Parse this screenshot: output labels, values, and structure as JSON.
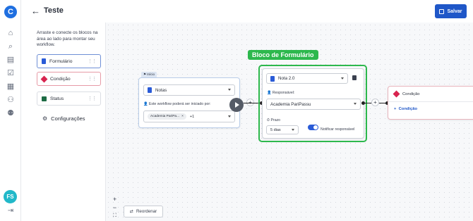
{
  "header": {
    "title": "Teste",
    "save_label": "Salvar"
  },
  "rail": {
    "avatar_initials": "FS",
    "icons": [
      "home-icon",
      "search-doc-icon",
      "document-icon",
      "checklist-icon",
      "chart-icon",
      "org-icon",
      "users-icon"
    ]
  },
  "panel": {
    "hint": "Arraste e conecte os blocos na área ao lado para montar seu workflow.",
    "blocks": [
      {
        "label": "Formulário",
        "color": "#2a5bd7"
      },
      {
        "label": "Condição",
        "color": "#d8244f"
      },
      {
        "label": "Status",
        "color": "#1d6b44"
      }
    ],
    "config_label": "Configurações"
  },
  "canvas": {
    "start_node": {
      "tag": "Início",
      "form_select": "Notas",
      "start_label": "Este workflow poderá ser iniciado por:",
      "chip": "Academia PariPa...",
      "extra": "+1"
    },
    "highlight_label": "Bloco de Formulário",
    "form_node": {
      "form_select": "Nota 2.0",
      "responsible_label": "Responsável:",
      "responsible_value": "Academia PariPassu",
      "deadline_label": "Prazo",
      "deadline_value": "5 dias",
      "notify_label": "Notificar responsável",
      "notify_on": true
    },
    "condition_node": {
      "title": "Condição",
      "add_label": "Condição"
    },
    "reorder_label": "Reordenar",
    "zoom_in": "+",
    "zoom_out": "−",
    "fit": "⛶"
  }
}
